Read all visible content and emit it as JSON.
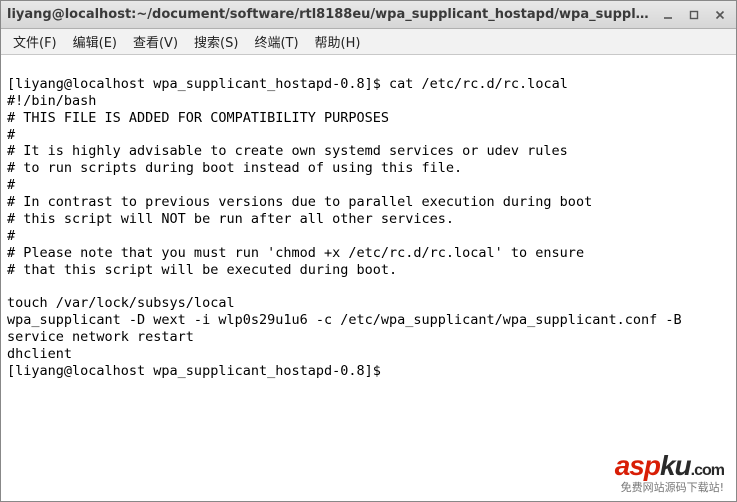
{
  "window": {
    "title": "liyang@localhost:~/document/software/rtl8188eu/wpa_supplicant_hostapd/wpa_suppli···"
  },
  "menu": {
    "file": "文件(F)",
    "edit": "编辑(E)",
    "view": "查看(V)",
    "search": "搜索(S)",
    "term": "终端(T)",
    "help": "帮助(H)"
  },
  "terminal": {
    "prompt1_user": "[liyang@localhost wpa_supplicant_hostapd-0.8]$ ",
    "cmd1": "cat /etc/rc.d/rc.local",
    "output": "#!/bin/bash\n# THIS FILE IS ADDED FOR COMPATIBILITY PURPOSES\n#\n# It is highly advisable to create own systemd services or udev rules\n# to run scripts during boot instead of using this file.\n#\n# In contrast to previous versions due to parallel execution during boot\n# this script will NOT be run after all other services.\n#\n# Please note that you must run 'chmod +x /etc/rc.d/rc.local' to ensure\n# that this script will be executed during boot.\n\ntouch /var/lock/subsys/local\nwpa_supplicant -D wext -i wlp0s29u1u6 -c /etc/wpa_supplicant/wpa_supplicant.conf -B\nservice network restart\ndhclient",
    "prompt2_user": "[liyang@localhost wpa_supplicant_hostapd-0.8]$ "
  },
  "watermark": {
    "brand_red": "asp",
    "brand_dark": "ku",
    "brand_com": ".com",
    "subtitle": "免费网站源码下载站!"
  }
}
